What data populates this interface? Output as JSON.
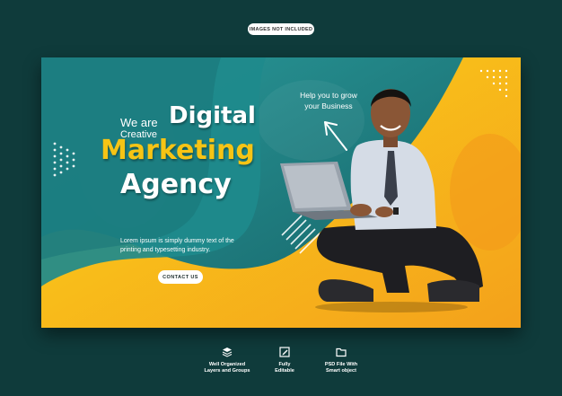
{
  "badge": "IMAGES NOT INCLUDED",
  "headline": {
    "we_are": "We are",
    "creative": "Creative",
    "digital": "Digital",
    "marketing": "Marketing",
    "agency": "Agency"
  },
  "tagline": {
    "line1": "Help you to grow",
    "line2": "your Business"
  },
  "body_text": "Lorem ipsum is simply dummy text of the printing and typesetting industry.",
  "cta_label": "CONTACT US",
  "features": [
    {
      "icon": "layers-icon",
      "line1": "Well Organized",
      "line2": "Layers and Groups"
    },
    {
      "icon": "edit-icon",
      "line1": "Fully",
      "line2": "Editable"
    },
    {
      "icon": "folder-icon",
      "line1": "PSD File With",
      "line2": "Smart object"
    }
  ],
  "colors": {
    "page_bg": "#0f3b3b",
    "banner_teal": "#1b7f82",
    "accent_yellow": "#f6c415",
    "accent_orange": "#f3a21b"
  }
}
